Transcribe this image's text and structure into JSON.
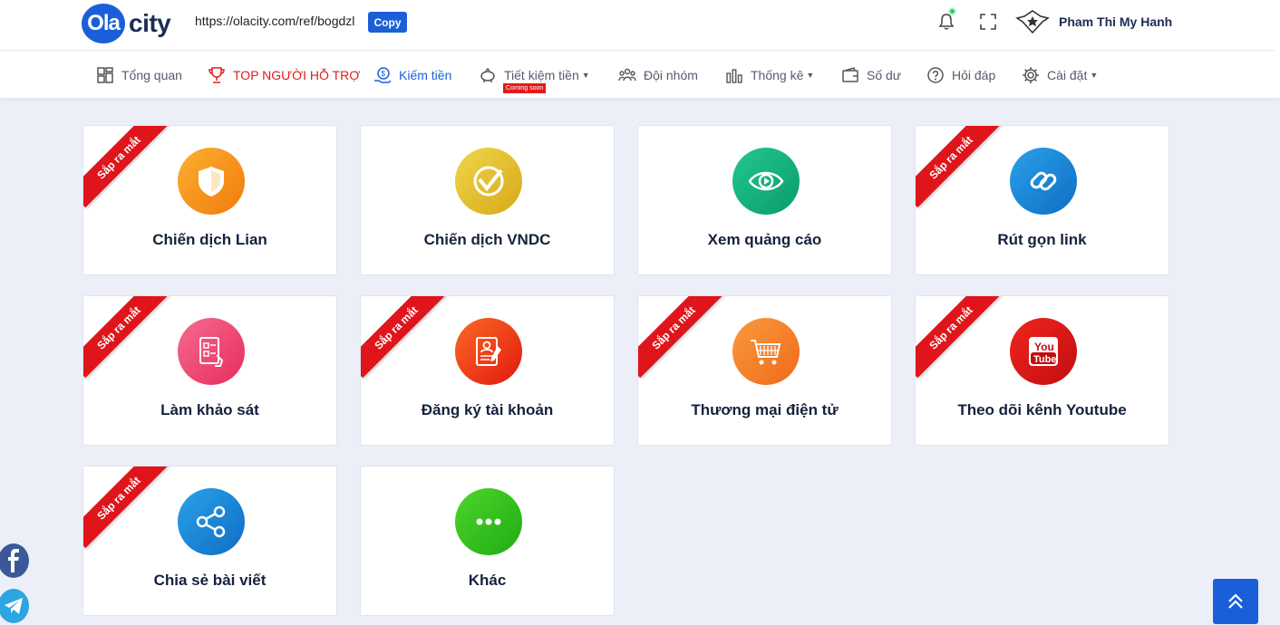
{
  "header": {
    "logo_badge": "Ola",
    "logo_text": "city",
    "ref_link": "https://olacity.com/ref/bogdzl",
    "copy_label": "Copy",
    "user_name": "Pham Thi My Hanh"
  },
  "nav": {
    "items": [
      {
        "label": "Tổng quan",
        "icon": "dashboard-icon"
      },
      {
        "label": "TOP NGƯỜI HỖ TRỢ",
        "icon": "trophy-icon"
      },
      {
        "label": "Kiếm tiền",
        "icon": "money-hand-icon"
      },
      {
        "label": "Tiết kiệm tiền",
        "icon": "piggy-bank-icon"
      },
      {
        "label": "Đội nhóm",
        "icon": "team-icon"
      },
      {
        "label": "Thống kê",
        "icon": "chart-icon"
      },
      {
        "label": "Số dư",
        "icon": "wallet-icon"
      },
      {
        "label": "Hỏi đáp",
        "icon": "question-icon"
      },
      {
        "label": "Cài đặt",
        "icon": "gear-icon"
      }
    ],
    "coming_soon": "Coming soon"
  },
  "ribbon_label": "Sắp ra mắt",
  "cards": [
    {
      "title": "Chiến dịch Lian",
      "icon": "shield-icon",
      "color": "#f7931e"
    },
    {
      "title": "Chiến dịch VNDC",
      "icon": "vndc-icon",
      "color": "#e5c22a"
    },
    {
      "title": "Xem quảng cáo",
      "icon": "eye-play-icon",
      "color": "#14b57f"
    },
    {
      "title": "Rút gọn link",
      "icon": "link-icon",
      "color": "#1a87d8"
    },
    {
      "title": "Làm khảo sát",
      "icon": "survey-icon",
      "color": "#f2466e"
    },
    {
      "title": "Đăng ký tài khoản",
      "icon": "register-icon",
      "color": "#f2421c"
    },
    {
      "title": "Thương mại điện tử",
      "icon": "cart-icon",
      "color": "#f5822a"
    },
    {
      "title": "Theo dõi kênh Youtube",
      "icon": "youtube-icon",
      "color": "#e0141b"
    },
    {
      "title": "Chia sẻ bài viết",
      "icon": "share-icon",
      "color": "#1a87d8"
    },
    {
      "title": "Khác",
      "icon": "more-icon",
      "color": "#2cc01a"
    }
  ]
}
